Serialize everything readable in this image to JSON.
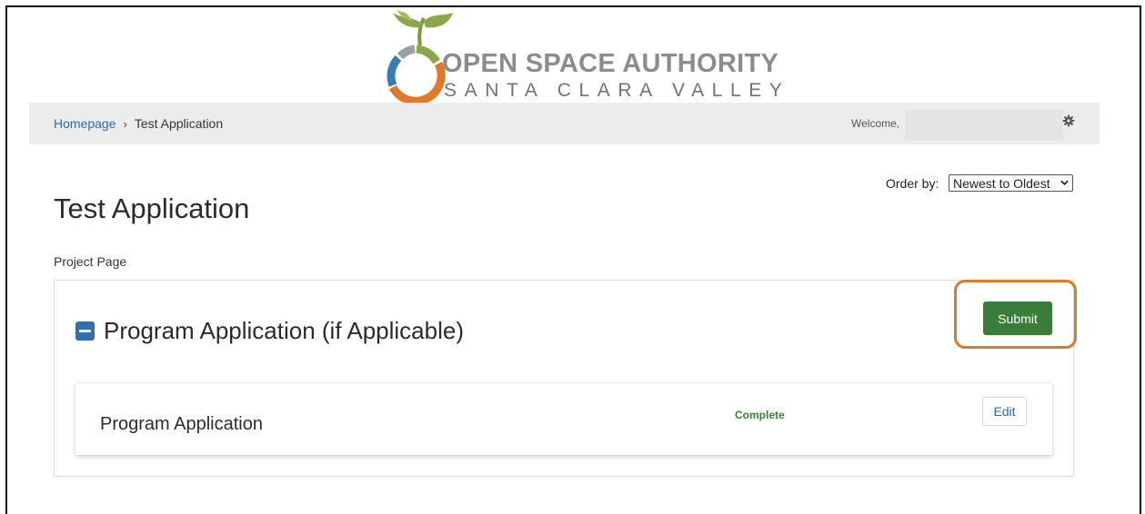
{
  "logo": {
    "line1": "OPEN SPACE AUTHORITY",
    "line2": "SANTA CLARA VALLEY"
  },
  "navbar": {
    "breadcrumb": [
      {
        "label": "Homepage"
      },
      {
        "label": "Test Application"
      }
    ],
    "breadcrumb_separator": "›",
    "welcome_label": "Welcome,",
    "settings_icon": "gear-icon"
  },
  "order_by": {
    "label": "Order by:",
    "selected": "Newest to Oldest"
  },
  "page": {
    "title": "Test Application",
    "subtitle": "Project Page"
  },
  "section": {
    "title": "Program Application (if Applicable)",
    "submit_label": "Submit",
    "items": [
      {
        "title": "Program Application",
        "status": "Complete",
        "edit_label": "Edit"
      }
    ]
  },
  "colors": {
    "accent_green": "#3a7d38",
    "link_blue": "#2f6aa8",
    "highlight_orange": "#e07a28"
  }
}
